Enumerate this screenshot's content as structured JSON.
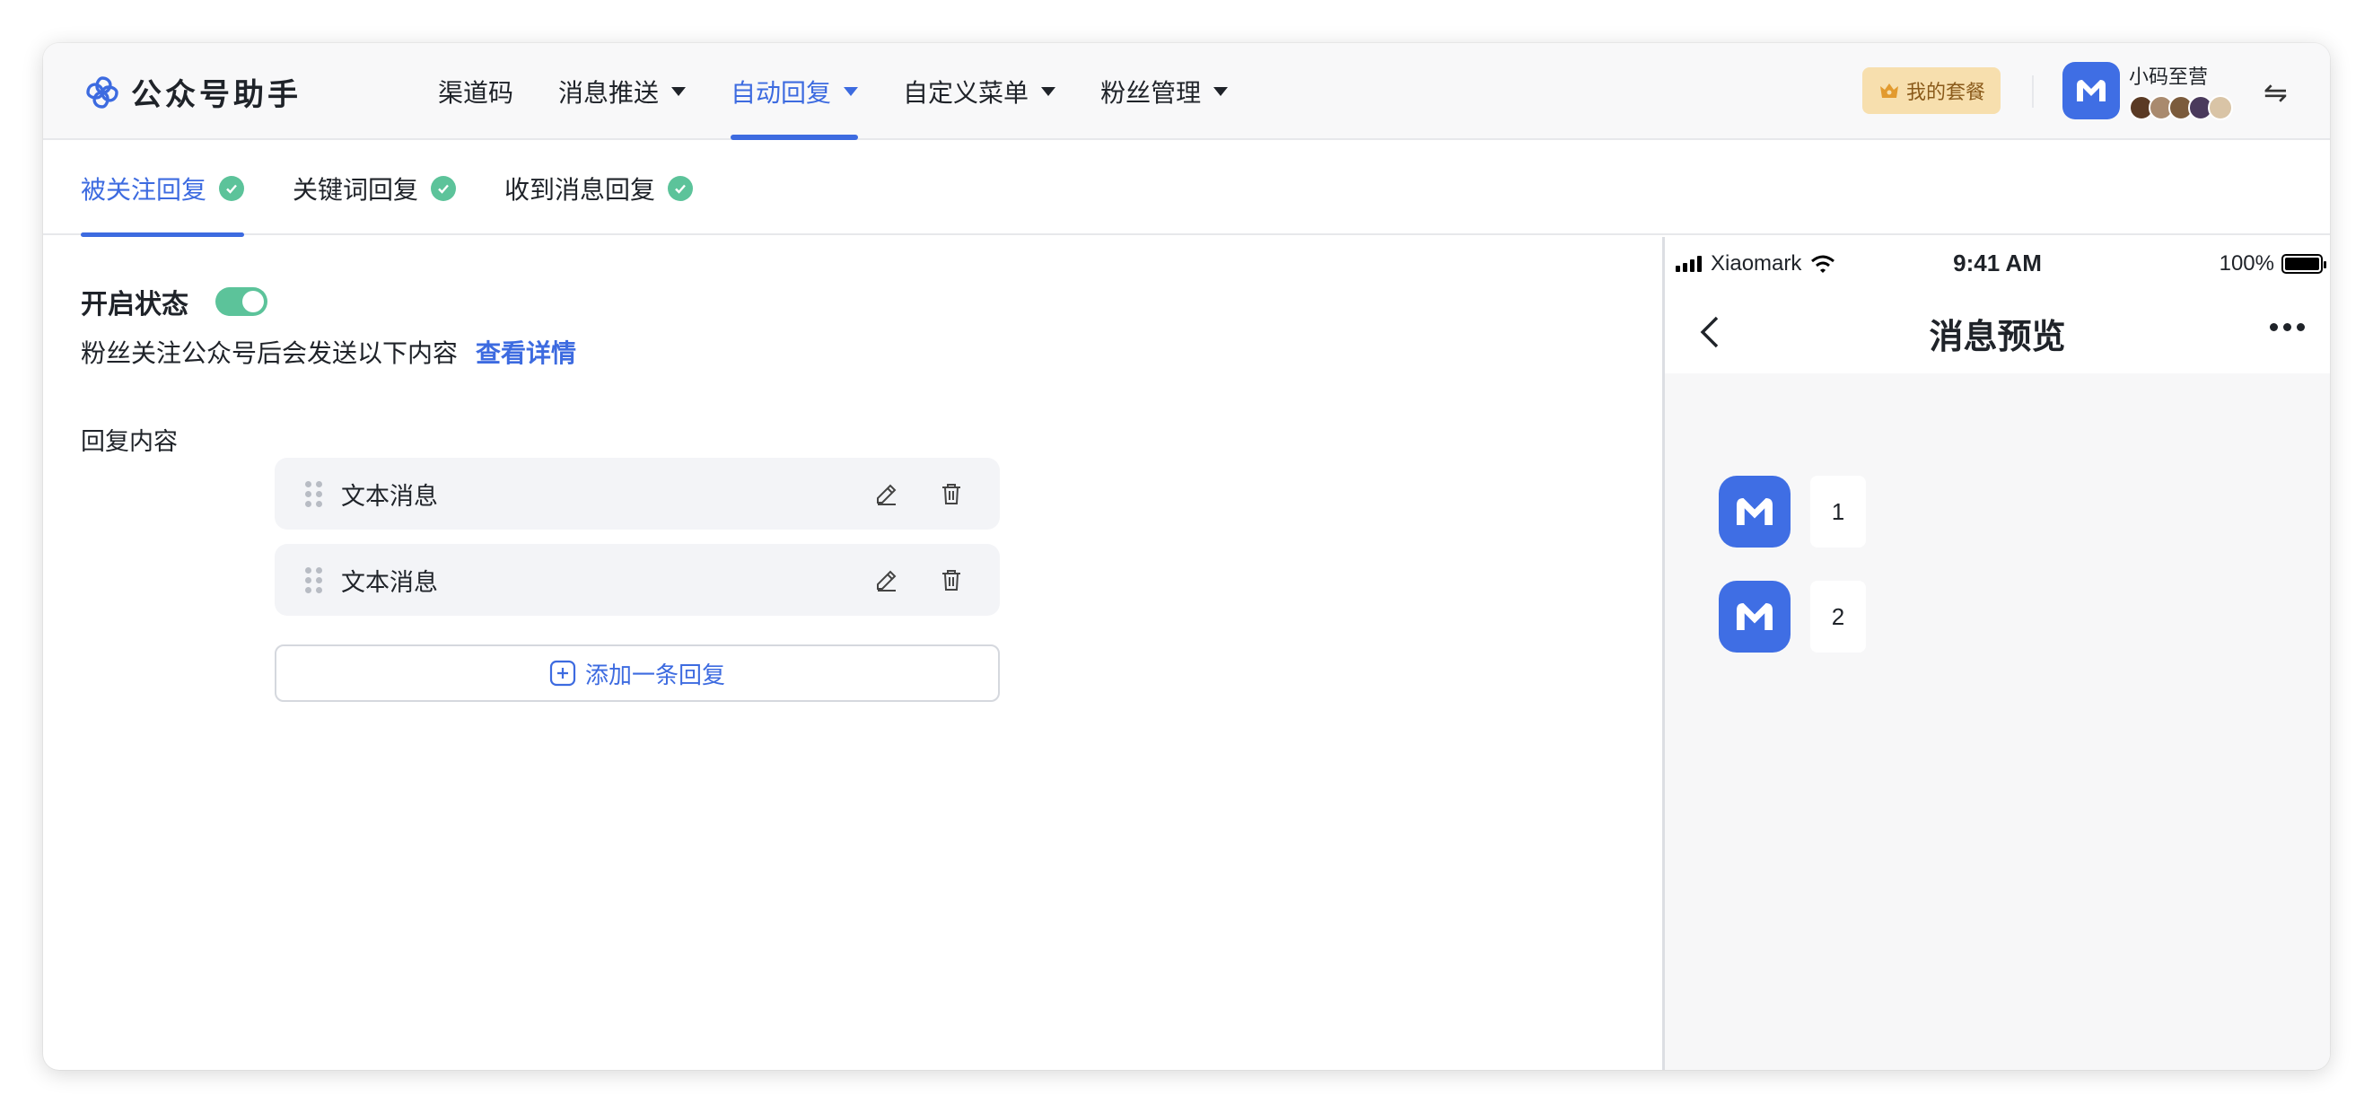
{
  "brand": {
    "name": "公众号助手",
    "logo_icon": "clover-logo-icon"
  },
  "nav": {
    "items": [
      {
        "label": "渠道码",
        "has_caret": false,
        "active": false
      },
      {
        "label": "消息推送",
        "has_caret": true,
        "active": false
      },
      {
        "label": "自动回复",
        "has_caret": true,
        "active": true
      },
      {
        "label": "自定义菜单",
        "has_caret": true,
        "active": false
      },
      {
        "label": "粉丝管理",
        "has_caret": true,
        "active": false
      }
    ]
  },
  "header": {
    "plan_label": "我的套餐",
    "user_name": "小码至营",
    "swap_glyph": "⇋"
  },
  "tabs": [
    {
      "label": "被关注回复",
      "active": true
    },
    {
      "label": "关键词回复",
      "active": false
    },
    {
      "label": "收到消息回复",
      "active": false
    }
  ],
  "settings": {
    "status_label": "开启状态",
    "enabled": true,
    "description": "粉丝关注公众号后会发送以下内容",
    "details_link": "查看详情",
    "reply_label": "回复内容",
    "replies": [
      {
        "text": "文本消息"
      },
      {
        "text": "文本消息"
      }
    ],
    "add_label": "添加一条回复"
  },
  "preview": {
    "carrier": "Xiaomark",
    "time": "9:41 AM",
    "battery": "100%",
    "title": "消息预览",
    "messages": [
      "1",
      "2"
    ]
  },
  "colors": {
    "accent": "#3d6be0",
    "success": "#5cc39a",
    "avatar": "#3f6ee4",
    "plan_bg": "#f7dfae"
  }
}
